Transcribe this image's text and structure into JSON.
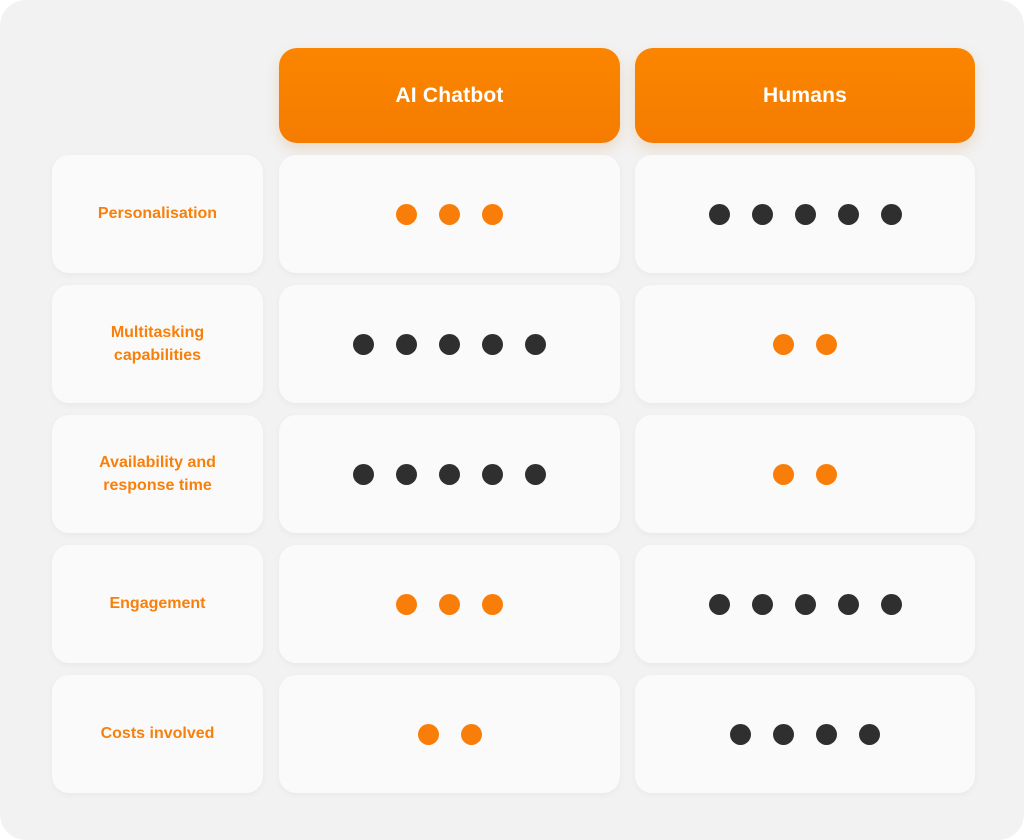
{
  "panel": {
    "background_color": "#F2F2F2",
    "card_color": "#FAFAFA",
    "accent_color": "#F97D09",
    "dark_color": "#2F2F2F",
    "header_text_color": "#FFFFFF"
  },
  "columns": [
    {
      "key": "label",
      "label": ""
    },
    {
      "key": "ai_chatbot",
      "label": "AI Chatbot"
    },
    {
      "key": "humans",
      "label": "Humans"
    }
  ],
  "rating_scale": {
    "max": 5,
    "filled_symbol": "dot"
  },
  "rows": [
    {
      "label": "Personalisation",
      "ai_chatbot": {
        "score": 3,
        "dot_color": "accent"
      },
      "humans": {
        "score": 5,
        "dot_color": "dark"
      }
    },
    {
      "label": "Multitasking capabilities",
      "ai_chatbot": {
        "score": 5,
        "dot_color": "dark"
      },
      "humans": {
        "score": 2,
        "dot_color": "accent"
      }
    },
    {
      "label": "Availability and response time",
      "ai_chatbot": {
        "score": 5,
        "dot_color": "dark"
      },
      "humans": {
        "score": 2,
        "dot_color": "accent"
      }
    },
    {
      "label": "Engagement",
      "ai_chatbot": {
        "score": 3,
        "dot_color": "accent"
      },
      "humans": {
        "score": 5,
        "dot_color": "dark"
      }
    },
    {
      "label": "Costs involved",
      "ai_chatbot": {
        "score": 2,
        "dot_color": "accent"
      },
      "humans": {
        "score": 4,
        "dot_color": "dark"
      }
    }
  ]
}
